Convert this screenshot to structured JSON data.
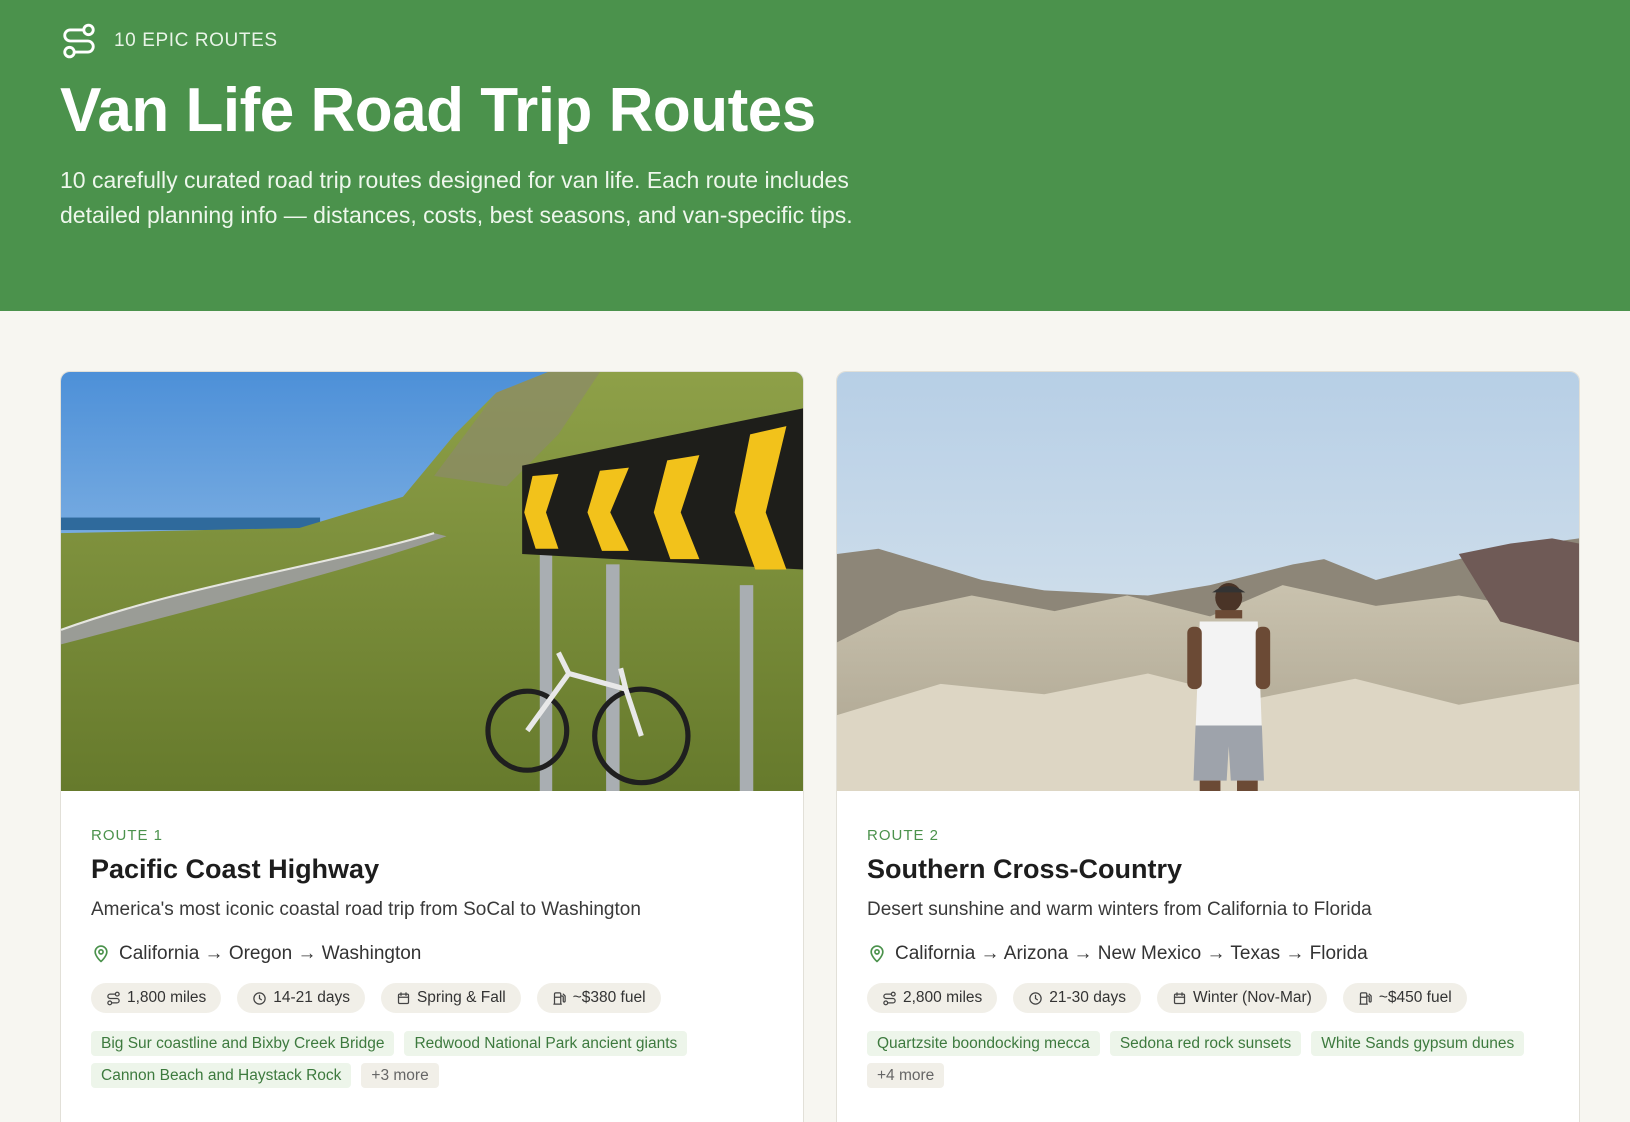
{
  "hero": {
    "eyebrow": "10 EPIC ROUTES",
    "title": "Van Life Road Trip Routes",
    "subtitle_line1": "10 carefully curated road trip routes designed for van life. Each route includes",
    "subtitle_line2": "detailed planning info — distances, costs, best seasons, and van-specific tips."
  },
  "routes": [
    {
      "number": "ROUTE 1",
      "title": "Pacific Coast Highway",
      "description": "America's most iconic coastal road trip from SoCal to Washington",
      "path": "California → Oregon → Washington",
      "distance": "1,800 miles",
      "duration": "14-21 days",
      "season": "Spring & Fall",
      "fuel": "~$380 fuel",
      "highlights": [
        "Big Sur coastline and Bixby Creek Bridge",
        "Redwood National Park ancient giants",
        "Cannon Beach and Haystack Rock"
      ],
      "more": "+3 more",
      "image_icon": "coastal-road-chevron-sign-bicycle"
    },
    {
      "number": "ROUTE 2",
      "title": "Southern Cross-Country",
      "description": "Desert sunshine and warm winters from California to Florida",
      "path": "California → Arizona → New Mexico → Texas → Florida",
      "distance": "2,800 miles",
      "duration": "21-30 days",
      "season": "Winter (Nov-Mar)",
      "fuel": "~$450 fuel",
      "highlights": [
        "Quartzsite boondocking mecca",
        "Sedona red rock sunsets",
        "White Sands gypsum dunes"
      ],
      "more": "+4 more",
      "image_icon": "desert-badlands-hiker"
    }
  ],
  "colors": {
    "brand_green": "#4b924c",
    "page_background": "#f7f6f1",
    "tag_green": "#3d7a3e"
  }
}
